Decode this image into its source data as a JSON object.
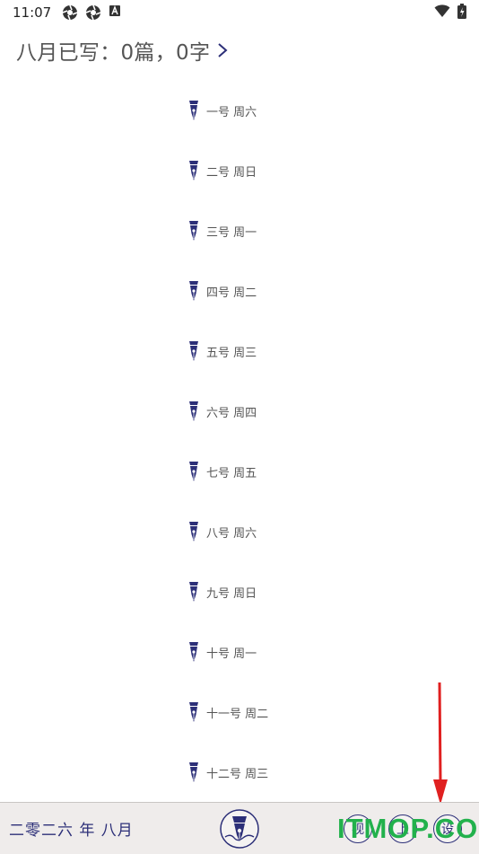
{
  "status_bar": {
    "time": "11:07",
    "left_icons": [
      "aperture-icon",
      "aperture-icon",
      "a-box-icon"
    ],
    "right_icons": [
      "wifi-icon",
      "battery-icon"
    ]
  },
  "header": {
    "summary": "八月已写：0篇，0字",
    "chevron_icon": "chevron-right-icon"
  },
  "days": [
    {
      "label": "一号 周六"
    },
    {
      "label": "二号 周日"
    },
    {
      "label": "三号 周一"
    },
    {
      "label": "四号 周二"
    },
    {
      "label": "五号 周三"
    },
    {
      "label": "六号 周四"
    },
    {
      "label": "七号 周五"
    },
    {
      "label": "八号 周六"
    },
    {
      "label": "九号 周日"
    },
    {
      "label": "十号 周一"
    },
    {
      "label": "十一号 周二"
    },
    {
      "label": "十二号 周三"
    }
  ],
  "bottom_bar": {
    "month_label": "二零二六 年 八月",
    "logo_icon": "fountain-pen-logo-icon",
    "buttons": [
      {
        "label": "视"
      },
      {
        "label": "上"
      },
      {
        "label": "设"
      }
    ]
  },
  "watermark": "ITMOP.COM",
  "colors": {
    "accent": "#2c2f78",
    "bottom_bar_bg": "#efeceb",
    "watermark": "#22b14c",
    "arrow": "#e02020"
  }
}
